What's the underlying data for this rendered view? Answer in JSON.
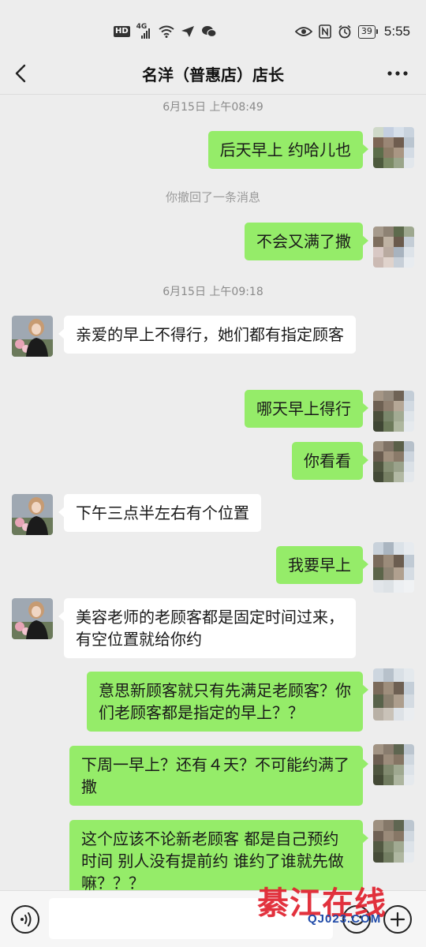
{
  "status_bar": {
    "hd": "HD",
    "network": "4G",
    "battery": "39",
    "time": "5:55"
  },
  "nav": {
    "title": "名洋（普惠店）店长"
  },
  "messages": {
    "ts1": "6月15日 上午08:49",
    "m1": "后天早上 约哈儿也",
    "sys1": "你撤回了一条消息",
    "m2": "不会又满了撒",
    "ts2": "6月15日 上午09:18",
    "m3": "亲爱的早上不得行，她们都有指定顾客",
    "m4": "哪天早上得行",
    "m5": "你看看",
    "m6": "下午三点半左右有个位置",
    "m7": "我要早上",
    "m8": "美容老师的老顾客都是固定时间过来，有空位置就给你约",
    "m9": "意思新顾客就只有先满足老顾客？你们老顾客都是指定的早上？？",
    "m10": "下周一早上？还有４天？不可能约满了撒",
    "m11": "这个应该不论新老顾客 都是自己预约时间 别人没有提前约 谁约了谁就先做嘛？？？"
  },
  "input": {
    "placeholder": ""
  },
  "watermark": {
    "brand": "綦江在线",
    "url": "QJ023.COM"
  },
  "colors": {
    "background": "#ededed",
    "outgoing_bubble": "#95ec69",
    "incoming_bubble": "#ffffff"
  }
}
